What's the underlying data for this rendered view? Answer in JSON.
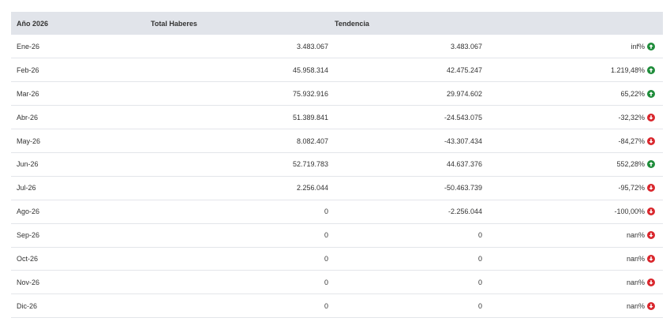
{
  "table": {
    "headers": {
      "year": "Año 2026",
      "total": "Total Haberes",
      "trend": "Tendencia"
    },
    "colors": {
      "up": "#1e8c3a",
      "down": "#d9262c",
      "header_bg": "#e1e4ea"
    },
    "rows": [
      {
        "month": "Ene-26",
        "total": "3.483.067",
        "diff": "3.483.067",
        "pct": "inf%",
        "trend": "up"
      },
      {
        "month": "Feb-26",
        "total": "45.958.314",
        "diff": "42.475.247",
        "pct": "1.219,48%",
        "trend": "up"
      },
      {
        "month": "Mar-26",
        "total": "75.932.916",
        "diff": "29.974.602",
        "pct": "65,22%",
        "trend": "up"
      },
      {
        "month": "Abr-26",
        "total": "51.389.841",
        "diff": "-24.543.075",
        "pct": "-32,32%",
        "trend": "down"
      },
      {
        "month": "May-26",
        "total": "8.082.407",
        "diff": "-43.307.434",
        "pct": "-84,27%",
        "trend": "down"
      },
      {
        "month": "Jun-26",
        "total": "52.719.783",
        "diff": "44.637.376",
        "pct": "552,28%",
        "trend": "up"
      },
      {
        "month": "Jul-26",
        "total": "2.256.044",
        "diff": "-50.463.739",
        "pct": "-95,72%",
        "trend": "down"
      },
      {
        "month": "Ago-26",
        "total": "0",
        "diff": "-2.256.044",
        "pct": "-100,00%",
        "trend": "down"
      },
      {
        "month": "Sep-26",
        "total": "0",
        "diff": "0",
        "pct": "nan%",
        "trend": "down"
      },
      {
        "month": "Oct-26",
        "total": "0",
        "diff": "0",
        "pct": "nan%",
        "trend": "down"
      },
      {
        "month": "Nov-26",
        "total": "0",
        "diff": "0",
        "pct": "nan%",
        "trend": "down"
      },
      {
        "month": "Dic-26",
        "total": "0",
        "diff": "0",
        "pct": "nan%",
        "trend": "down"
      }
    ]
  }
}
